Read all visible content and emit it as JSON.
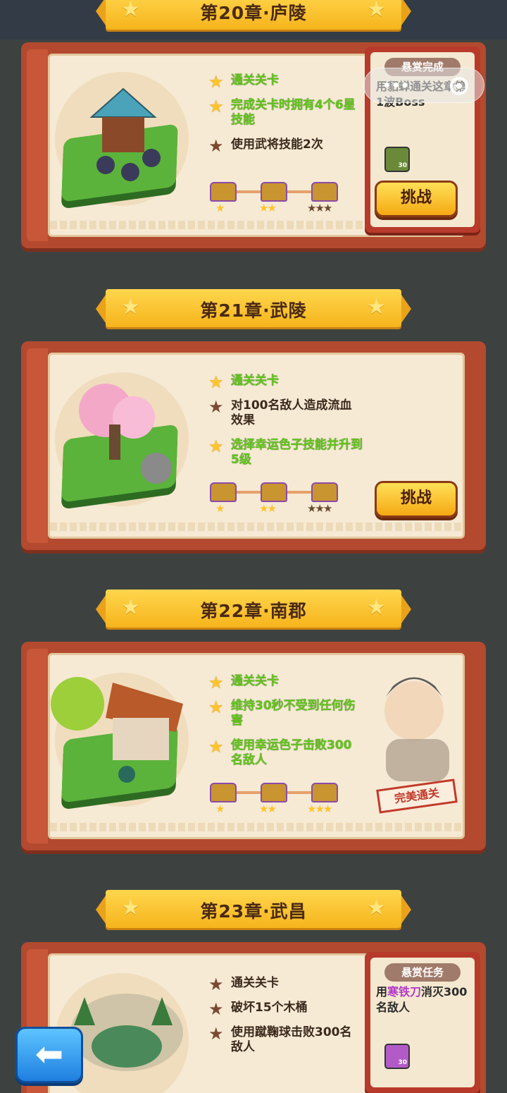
{
  "chapters": [
    {
      "title": "第20章·庐陵",
      "tasks": [
        {
          "text": "通关关卡",
          "done": true
        },
        {
          "text": "完成关卡时拥有4个6星技能",
          "done": true
        },
        {
          "text": "使用武将技能2次",
          "done": false
        }
      ],
      "button": "挑战",
      "bounty": {
        "tag": "悬赏完成",
        "text": "用貂蝉通关这章第1波Boss",
        "reward_count": "30"
      }
    },
    {
      "title": "第21章·武陵",
      "tasks": [
        {
          "text": "通关关卡",
          "done": true
        },
        {
          "text": "对100名敌人造成流血效果",
          "done": false
        },
        {
          "text": "选择幸运色子技能并升到5级",
          "done": true
        }
      ],
      "button": "挑战"
    },
    {
      "title": "第22章·南郡",
      "tasks": [
        {
          "text": "通关关卡",
          "done": true
        },
        {
          "text": "维持30秒不受到任何伤害",
          "done": true
        },
        {
          "text": "使用幸运色子击败300名敌人",
          "done": true
        }
      ],
      "stamp": "完美通关"
    },
    {
      "title": "第23章·武昌",
      "tasks": [
        {
          "text": "通关关卡",
          "done": false
        },
        {
          "text": "破坏15个木桶",
          "done": false
        },
        {
          "text": "使用蹴鞠球击败300名敌人",
          "done": false
        }
      ],
      "bounty": {
        "tag": "悬赏任务",
        "text_pre": "用",
        "text_hl": "寒铁刀",
        "text_post": "消灭300名敌人",
        "reward_count": "30"
      }
    }
  ],
  "icons": {
    "star": "★",
    "back": "⬅"
  },
  "colors": {
    "done_text": "#63c51c",
    "todo_text": "#3b2a1c",
    "gold": "#ffc52a"
  }
}
